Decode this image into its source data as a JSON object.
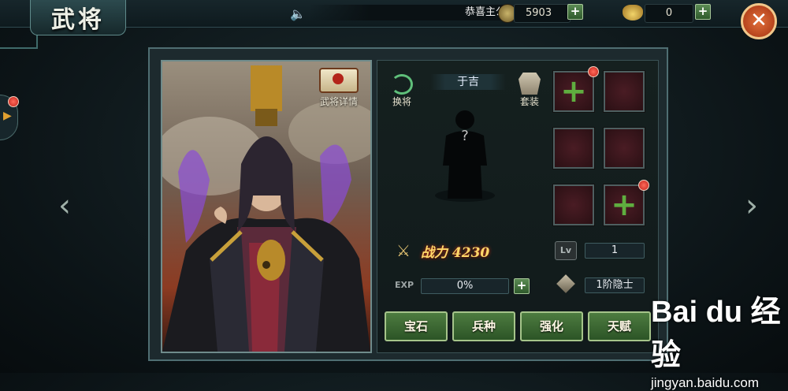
{
  "screen": {
    "title": "武将"
  },
  "topbar": {
    "broadcast_text": "恭喜主公",
    "coins": "5903",
    "ingots": "0",
    "add_label": "+",
    "close_label": "✕"
  },
  "general": {
    "detail_label": "武将详情",
    "name": "于吉",
    "swap_label": "换将",
    "outfit_label": "套装",
    "unknown_mark": "?",
    "power_label": "战力",
    "power_value": "4230",
    "lv_icon": "Lv",
    "level": "1",
    "exp_icon": "EXP",
    "exp_percent": "0%",
    "rank": "1阶隐士"
  },
  "actions": [
    {
      "label": "宝石"
    },
    {
      "label": "兵种"
    },
    {
      "label": "强化"
    },
    {
      "label": "天赋"
    }
  ],
  "watermark": {
    "logo": "Bai du 经验",
    "url": "jingyan.baidu.com"
  },
  "colors": {
    "accent_green": "#4d7c40",
    "power_gold": "#ffd86a",
    "close_orange": "#d9612f",
    "notify_red": "#e03a2a"
  }
}
